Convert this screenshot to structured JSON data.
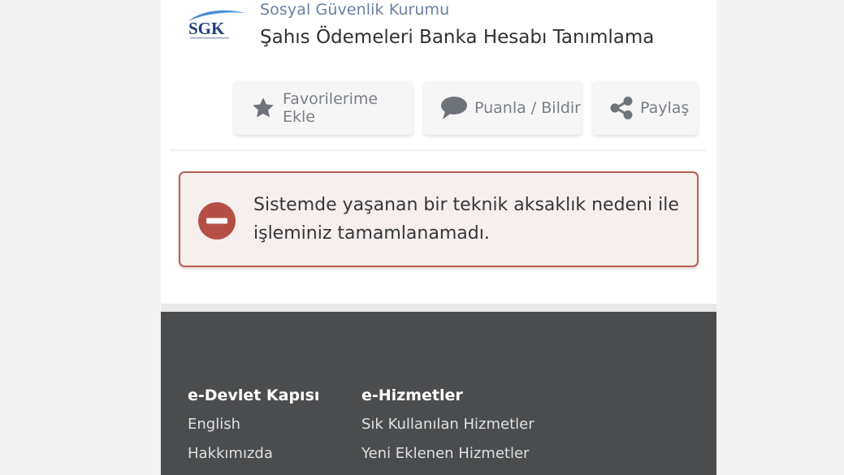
{
  "header": {
    "logo_text": "SGK",
    "org_name": "Sosyal Güvenlik Kurumu",
    "service_title": "Şahıs Ödemeleri Banka Hesabı Tanımlama"
  },
  "actions": {
    "favorite_label": "Favorilerime Ekle",
    "rate_label": "Puanla / Bildir",
    "share_label": "Paylaş"
  },
  "alert": {
    "line1": "Sistemde yaşanan bir teknik aksaklık nedeni ile",
    "line2": "işleminiz tamamlanamadı."
  },
  "footer": {
    "col1": {
      "heading": "e-Devlet Kapısı",
      "links": [
        "English",
        "Hakkımızda"
      ]
    },
    "col2": {
      "heading": "e-Hizmetler",
      "links": [
        "Sık Kullanılan Hizmetler",
        "Yeni Eklenen Hizmetler"
      ]
    }
  },
  "colors": {
    "alert_border": "#b85f55",
    "alert_icon": "#b54f45",
    "footer_bg": "#4a4c4e",
    "org_name": "#6a7fa3"
  }
}
